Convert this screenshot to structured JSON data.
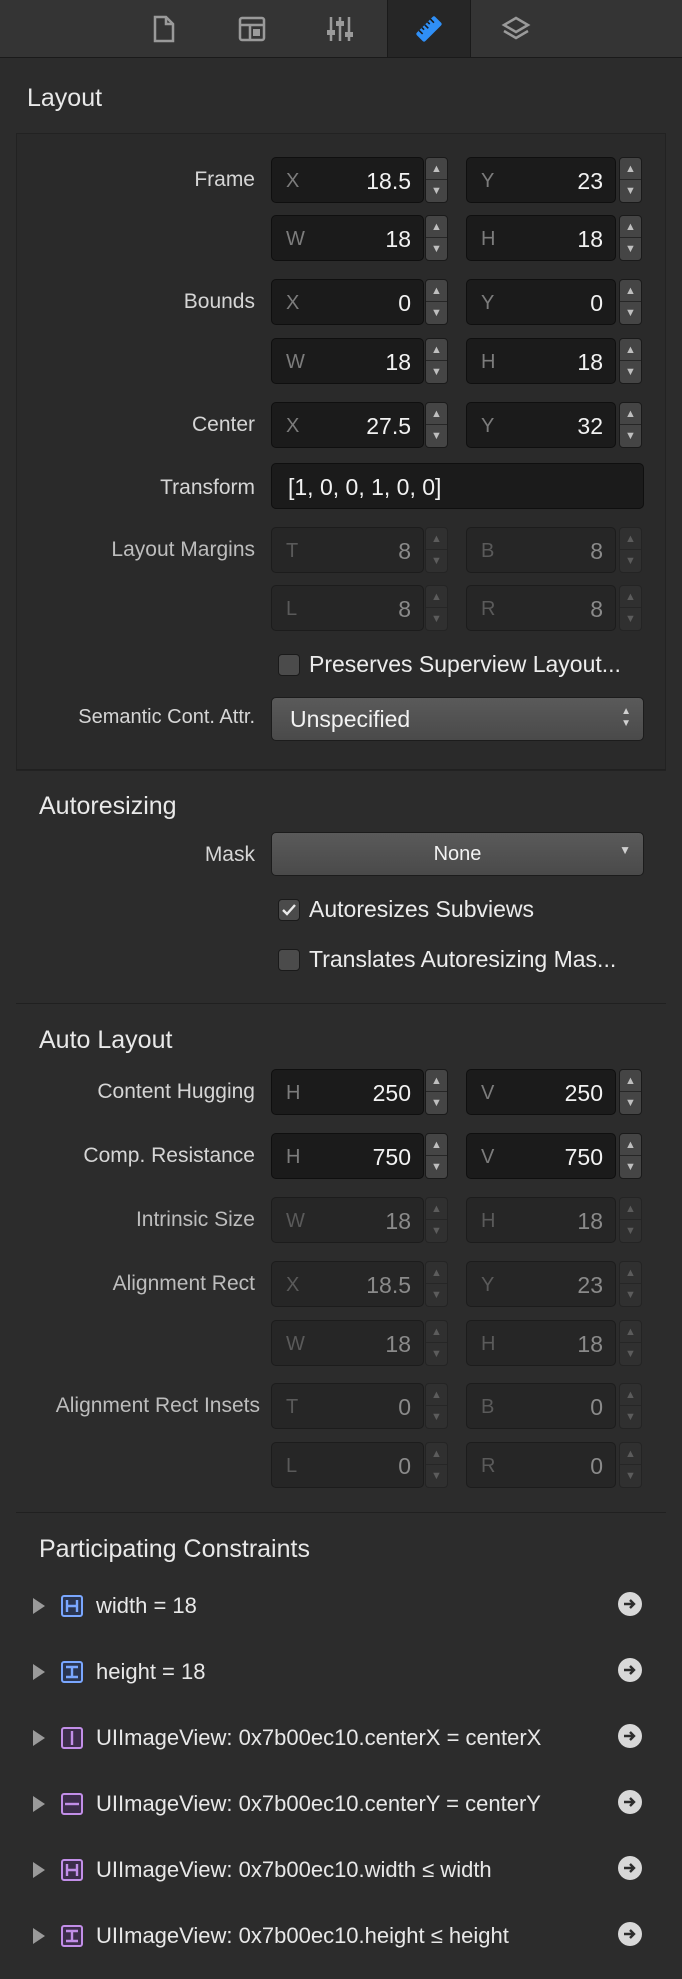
{
  "toolbar": {
    "tabs": [
      {
        "icon": "file-inspector-icon"
      },
      {
        "icon": "quick-help-icon"
      },
      {
        "icon": "attributes-inspector-icon"
      },
      {
        "icon": "size-inspector-icon"
      },
      {
        "icon": "connections-inspector-icon"
      }
    ],
    "active": 3
  },
  "layout": {
    "title": "Layout",
    "frame_label": "Frame",
    "frame": {
      "x": {
        "p": "X",
        "v": "18.5"
      },
      "y": {
        "p": "Y",
        "v": "23"
      },
      "w": {
        "p": "W",
        "v": "18"
      },
      "h": {
        "p": "H",
        "v": "18"
      }
    },
    "bounds_label": "Bounds",
    "bounds": {
      "x": {
        "p": "X",
        "v": "0"
      },
      "y": {
        "p": "Y",
        "v": "0"
      },
      "w": {
        "p": "W",
        "v": "18"
      },
      "h": {
        "p": "H",
        "v": "18"
      }
    },
    "center_label": "Center",
    "center": {
      "x": {
        "p": "X",
        "v": "27.5"
      },
      "y": {
        "p": "Y",
        "v": "32"
      }
    },
    "transform_label": "Transform",
    "transform_value": "[1, 0, 0, 1, 0, 0]",
    "margins_label": "Layout Margins",
    "margins": {
      "t": {
        "p": "T",
        "v": "8"
      },
      "b": {
        "p": "B",
        "v": "8"
      },
      "l": {
        "p": "L",
        "v": "8"
      },
      "r": {
        "p": "R",
        "v": "8"
      }
    },
    "preserves_label": "Preserves Superview Layout...",
    "preserves_checked": false,
    "semantic_label": "Semantic Cont. Attr.",
    "semantic_value": "Unspecified"
  },
  "autoresizing": {
    "title": "Autoresizing",
    "mask_label": "Mask",
    "mask_value": "None",
    "subviews_label": "Autoresizes Subviews",
    "subviews_checked": true,
    "translates_label": "Translates Autoresizing Mas...",
    "translates_checked": false
  },
  "auto_layout": {
    "title": "Auto Layout",
    "hugging_label": "Content Hugging",
    "hugging": {
      "h": {
        "p": "H",
        "v": "250"
      },
      "v": {
        "p": "V",
        "v": "250"
      }
    },
    "resistance_label": "Comp. Resistance",
    "resistance": {
      "h": {
        "p": "H",
        "v": "750"
      },
      "v": {
        "p": "V",
        "v": "750"
      }
    },
    "intrinsic_label": "Intrinsic Size",
    "intrinsic": {
      "w": {
        "p": "W",
        "v": "18"
      },
      "h": {
        "p": "H",
        "v": "18"
      }
    },
    "alignment_label": "Alignment Rect",
    "alignment": {
      "x": {
        "p": "X",
        "v": "18.5"
      },
      "y": {
        "p": "Y",
        "v": "23"
      },
      "w": {
        "p": "W",
        "v": "18"
      },
      "h": {
        "p": "H",
        "v": "18"
      }
    },
    "insets_label": "Alignment Rect Insets",
    "insets": {
      "t": {
        "p": "T",
        "v": "0"
      },
      "b": {
        "p": "B",
        "v": "0"
      },
      "l": {
        "p": "L",
        "v": "0"
      },
      "r": {
        "p": "R",
        "v": "0"
      }
    }
  },
  "constraints": {
    "title": "Participating Constraints",
    "items": [
      {
        "text": "width = 18",
        "icon": "width-constraint-icon",
        "color": "#7aa7ff"
      },
      {
        "text": "height = 18",
        "icon": "height-constraint-icon",
        "color": "#7aa7ff"
      },
      {
        "text": "UIImageView: 0x7b00ec10.centerX = centerX",
        "icon": "center-x-constraint-icon",
        "color": "#c28ee8"
      },
      {
        "text": "UIImageView: 0x7b00ec10.centerY = centerY",
        "icon": "center-y-constraint-icon",
        "color": "#c28ee8"
      },
      {
        "text": "UIImageView: 0x7b00ec10.width ≤ width",
        "icon": "width-constraint-icon",
        "color": "#c28ee8"
      },
      {
        "text": "UIImageView: 0x7b00ec10.height ≤ height",
        "icon": "height-constraint-icon",
        "color": "#c28ee8"
      }
    ]
  }
}
